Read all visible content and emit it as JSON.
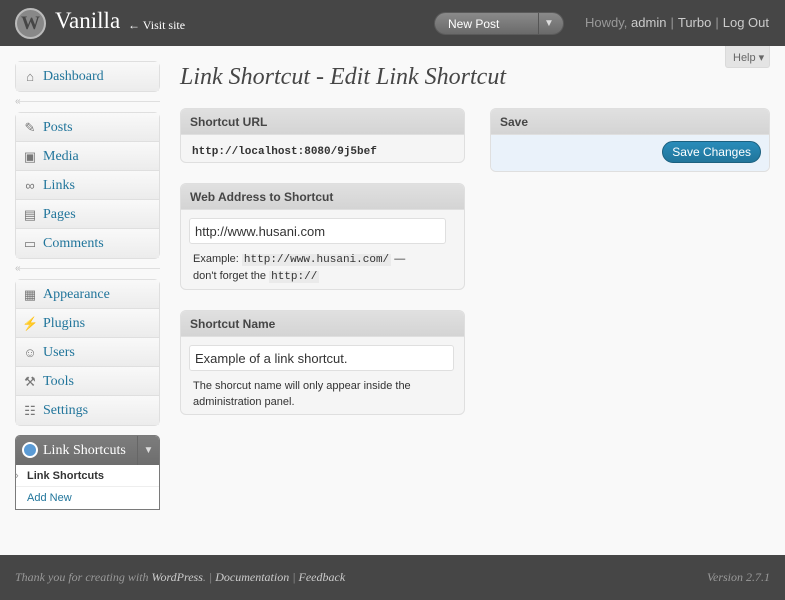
{
  "header": {
    "logo_glyph": "W",
    "site_title": "Vanilla",
    "visit_site": "← Visit site",
    "favorite_action": "New Post",
    "howdy": "Howdy,",
    "user": "admin",
    "turbo": "Turbo",
    "logout": "Log Out"
  },
  "help_tab": "Help ▾",
  "menu": {
    "dashboard": {
      "label": "Dashboard",
      "icon": "dashboard-icon"
    },
    "group1": [
      {
        "label": "Posts",
        "icon": "pin-icon"
      },
      {
        "label": "Media",
        "icon": "media-icon"
      },
      {
        "label": "Links",
        "icon": "link-icon"
      },
      {
        "label": "Pages",
        "icon": "page-icon"
      },
      {
        "label": "Comments",
        "icon": "comment-icon"
      }
    ],
    "group2": [
      {
        "label": "Appearance",
        "icon": "appearance-icon"
      },
      {
        "label": "Plugins",
        "icon": "plug-icon"
      },
      {
        "label": "Users",
        "icon": "users-icon"
      },
      {
        "label": "Tools",
        "icon": "tools-icon"
      },
      {
        "label": "Settings",
        "icon": "settings-icon"
      }
    ],
    "link_shortcuts": {
      "label": "Link Shortcuts",
      "submenu": [
        "Link Shortcuts",
        "Add New"
      ]
    }
  },
  "main": {
    "title": "Link Shortcut - Edit Link Shortcut",
    "shortcut_url": {
      "heading": "Shortcut URL",
      "value": "http://localhost:8080/9j5bef"
    },
    "web_address": {
      "heading": "Web Address to Shortcut",
      "value": "http://www.husani.com",
      "help_prefix": "Example:",
      "help_example": "http://www.husani.com/",
      "help_dash": " —",
      "help_middle": "don't forget the",
      "help_code": "http://"
    },
    "shortcut_name": {
      "heading": "Shortcut Name",
      "value": "Example of a link shortcut.",
      "help": "The shorcut name will only appear inside the administration panel."
    },
    "save_box": {
      "heading": "Save",
      "button": "Save Changes"
    }
  },
  "footer": {
    "thank_you": "Thank you for creating with",
    "wordpress": "WordPress",
    "documentation": "Documentation",
    "feedback": "Feedback",
    "version": "Version 2.7.1"
  },
  "colors": {
    "header_bg": "#464646",
    "link": "#21759b",
    "button": "#21759b",
    "save_inside": "#eaf2fa"
  }
}
